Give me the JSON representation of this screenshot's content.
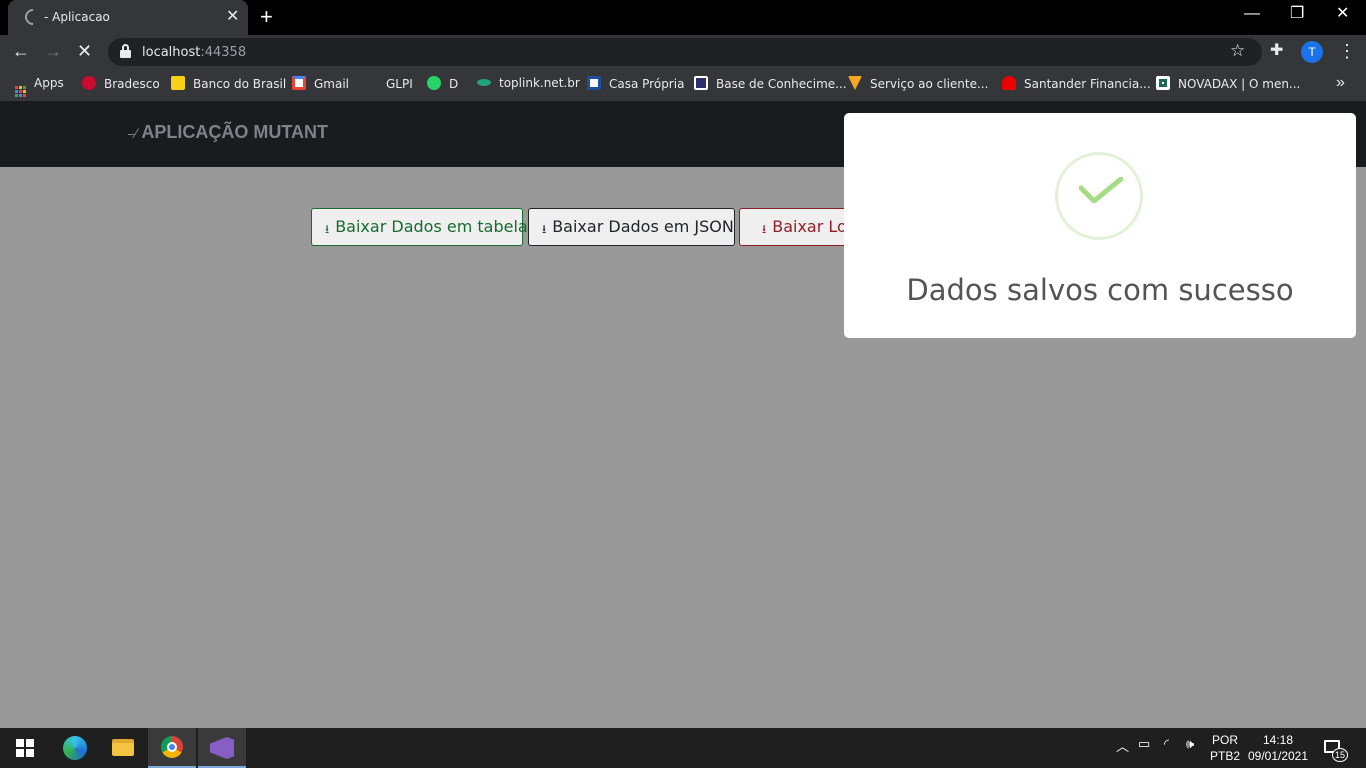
{
  "browser": {
    "tab_title": "- Aplicacao",
    "new_tab_label": "+",
    "url_host": "localhost",
    "url_port": ":44358",
    "profile_initial": "T",
    "window_controls": {
      "minimize": "—",
      "restore": "❐",
      "close": "✕"
    }
  },
  "bookmarks": [
    {
      "label": "Apps",
      "icon": "apps-grid-icon"
    },
    {
      "label": "Bradesco",
      "icon": "bradesco-icon",
      "color": "#cc092f"
    },
    {
      "label": "Banco do Brasil",
      "icon": "bb-icon",
      "color": "#f8d117"
    },
    {
      "label": "Gmail",
      "icon": "gmail-icon",
      "color": "#ea4335"
    },
    {
      "label": "GLPI",
      "icon": "glpi-icon",
      "color": "#35363a"
    },
    {
      "label": "D",
      "icon": "whatsapp-icon",
      "color": "#25d366"
    },
    {
      "label": "toplink.net.br",
      "icon": "toplink-icon",
      "color": "#1fa37a"
    },
    {
      "label": "Casa Própria",
      "icon": "casa-propria-icon",
      "color": "#1e4e9c"
    },
    {
      "label": "Base de Conhecime...",
      "icon": "base-conhecimento-icon",
      "color": "#2c2f6b"
    },
    {
      "label": "Serviço ao cliente...",
      "icon": "servico-cliente-icon",
      "color": "#f5a623"
    },
    {
      "label": "Santander Financia...",
      "icon": "santander-icon",
      "color": "#ec0000"
    },
    {
      "label": "NOVADAX | O men...",
      "icon": "novadax-icon",
      "color": "#ffffff"
    }
  ],
  "app": {
    "brand_icon": "⎯⁄",
    "brand": "APLICAÇÃO MUTANT",
    "buttons": {
      "table": "Baixar Dados em tabela",
      "json": "Baixar Dados em JSON",
      "log": "Baixar Log"
    },
    "toast_message": "Dados salvos com sucesso"
  },
  "taskbar": {
    "lang_top": "POR",
    "lang_bottom": "PTB2",
    "time": "14:18",
    "date": "09/01/2021",
    "notifications": "15"
  }
}
